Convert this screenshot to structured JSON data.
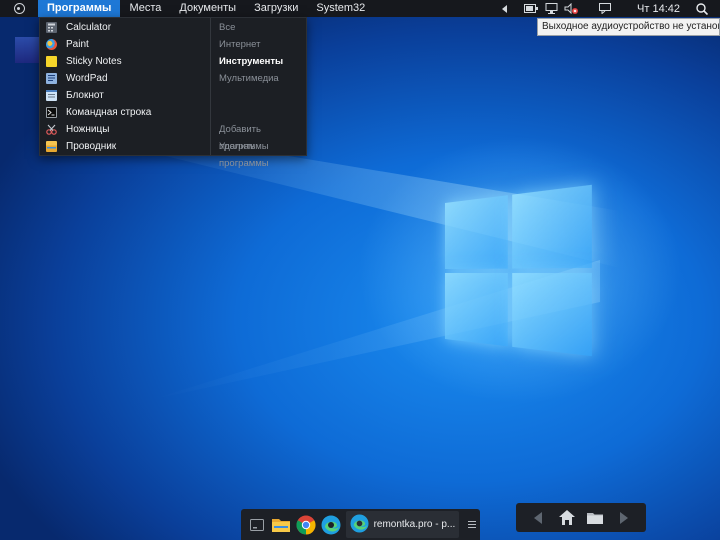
{
  "topbar": {
    "menu": [
      {
        "label": "Программы",
        "active": true
      },
      {
        "label": "Места"
      },
      {
        "label": "Документы"
      },
      {
        "label": "Загрузки"
      },
      {
        "label": "System32"
      }
    ],
    "tray_icons": [
      "chevron-left-icon",
      "battery-icon",
      "network-icon",
      "speaker-muted-icon",
      "notifications-icon"
    ],
    "clock": "Чт 14:42"
  },
  "tooltip": "Выходное аудиоустройство не установлено.",
  "programs_menu": {
    "programs": [
      {
        "label": "Calculator",
        "icon": "calculator-icon"
      },
      {
        "label": "Paint",
        "icon": "paint-icon"
      },
      {
        "label": "Sticky Notes",
        "icon": "sticky-notes-icon"
      },
      {
        "label": "WordPad",
        "icon": "wordpad-icon"
      },
      {
        "label": "Блокнот",
        "icon": "notepad-icon"
      },
      {
        "label": "Командная строка",
        "icon": "cmd-icon"
      },
      {
        "label": "Ножницы",
        "icon": "snipping-tool-icon"
      },
      {
        "label": "Проводник",
        "icon": "explorer-icon"
      }
    ],
    "categories": [
      {
        "label": "Все"
      },
      {
        "label": "Интернет"
      },
      {
        "label": "Инструменты",
        "selected": true
      },
      {
        "label": "Мультимедиа"
      }
    ],
    "actions": [
      {
        "label": "Добавить программы"
      },
      {
        "label": "Удалить программы"
      }
    ]
  },
  "dock": {
    "apps": [
      "show-desktop-icon",
      "file-explorer-icon",
      "chrome-icon",
      "edge-icon"
    ],
    "active_task": {
      "label": "remontka.pro - р...",
      "icon": "edge-icon"
    }
  },
  "nav_panel": [
    "back-arrow-icon",
    "home-icon",
    "folder-icon",
    "forward-arrow-icon"
  ],
  "colors": {
    "accent": "#1e78d6",
    "bar_bg": "#16181d",
    "menu_bg": "#1c1f24",
    "wallpaper": "#0e6bd6"
  }
}
